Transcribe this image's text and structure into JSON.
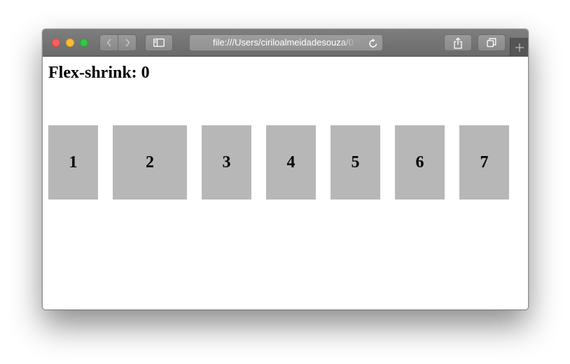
{
  "browser": {
    "url": "file:///Users/ciriloalmeidadesouza/0"
  },
  "page": {
    "heading": "Flex-shrink: 0",
    "items": [
      "1",
      "2",
      "3",
      "4",
      "5",
      "6",
      "7"
    ]
  }
}
